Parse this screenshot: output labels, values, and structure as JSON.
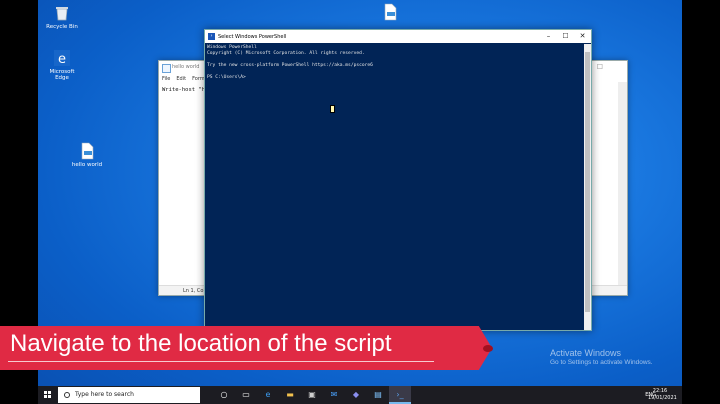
{
  "desktop_icons": [
    {
      "label": "Recycle Bin",
      "icon": "recycle-bin-icon"
    },
    {
      "label": "Microsoft Edge",
      "icon": "edge-icon"
    },
    {
      "label": "hello world",
      "icon": "script-file-icon"
    }
  ],
  "notepad": {
    "title": "hello world",
    "menu": [
      "File",
      "Edit",
      "Forma"
    ],
    "text": "Write-host \"h",
    "status": "Ln 1, Col"
  },
  "powershell": {
    "title": "Select Windows PowerShell",
    "lines": [
      "Windows PowerShell",
      "Copyright (C) Microsoft Corporation. All rights reserved.",
      "",
      "Try the new cross-platform PowerShell https://aka.ms/pscore6",
      "",
      "PS C:\\Users\\A>"
    ]
  },
  "banner": {
    "text": "Navigate to the location of the script"
  },
  "watermark": {
    "line1": "Activate Windows",
    "line2": "Go to Settings to activate Windows."
  },
  "taskbar": {
    "search_placeholder": "Type here to search",
    "icons": [
      "cortana-icon",
      "task-view-icon",
      "edge-icon",
      "file-explorer-icon",
      "store-icon",
      "mail-icon",
      "teams-icon",
      "notepad-icon",
      "powershell-icon"
    ],
    "tray_text": "ENG",
    "time": "22:16",
    "date": "19/01/2021"
  },
  "colors": {
    "accent": "#e02a44",
    "console_bg": "#012456"
  }
}
